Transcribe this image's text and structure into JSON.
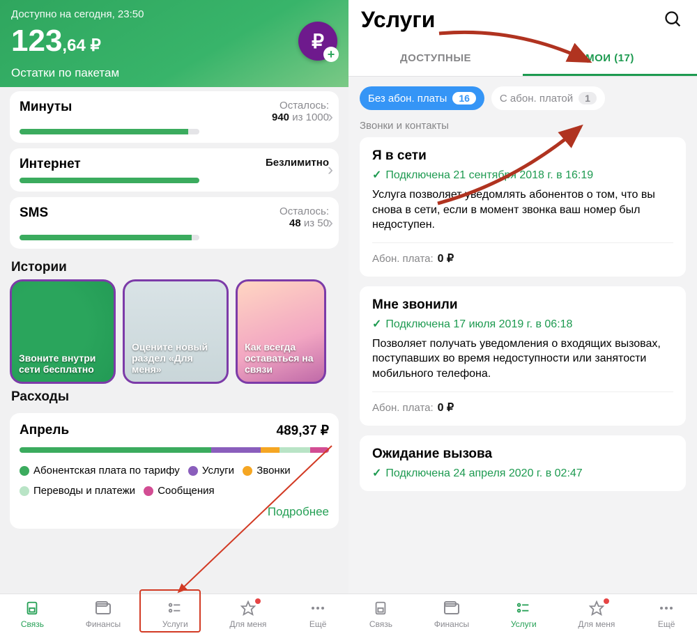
{
  "left": {
    "avail_label": "Доступно на сегодня, 23:50",
    "balance_int": "123",
    "balance_dec": ",64 ₽",
    "packs_header": "Остатки по пакетам",
    "packs": [
      {
        "name": "Минуты",
        "left_label": "Осталось:",
        "value": "940",
        "of": " из 1000",
        "pct": 94
      },
      {
        "name": "Интернет",
        "left_label": "",
        "value": "Безлимитно",
        "of": "",
        "pct": 100
      },
      {
        "name": "SMS",
        "left_label": "Осталось:",
        "value": "48",
        "of": " из 50",
        "pct": 96
      }
    ],
    "stories_header": "Истории",
    "stories": [
      "Звоните внутри сети бесплатно",
      "Оцените новый раздел «Для меня»",
      "Как всегда оставаться на связи"
    ],
    "expenses_header": "Расходы",
    "expenses": {
      "month": "Апрель",
      "total": "489,37 ₽",
      "segments": [
        {
          "color": "#3bab5e",
          "pct": 62
        },
        {
          "color": "#8a5ebc",
          "pct": 16
        },
        {
          "color": "#f5a623",
          "pct": 6
        },
        {
          "color": "#b9e4c6",
          "pct": 10
        },
        {
          "color": "#d24d93",
          "pct": 6
        }
      ],
      "legend": [
        {
          "color": "#3bab5e",
          "label": "Абонентская плата по тарифу"
        },
        {
          "color": "#8a5ebc",
          "label": "Услуги"
        },
        {
          "color": "#f5a623",
          "label": "Звонки"
        },
        {
          "color": "#b9e4c6",
          "label": "Переводы и платежи"
        },
        {
          "color": "#d24d93",
          "label": "Сообщения"
        }
      ],
      "more": "Подробнее"
    }
  },
  "right": {
    "title": "Услуги",
    "tabs": {
      "available": "ДОСТУПНЫЕ",
      "mine": "МОИ (17)"
    },
    "chips": {
      "no_fee": {
        "label": "Без абон. платы",
        "count": "16"
      },
      "with_fee": {
        "label": "С абон. платой",
        "count": "1"
      }
    },
    "group_label": "Звонки и контакты",
    "services": [
      {
        "name": "Я в сети",
        "connected": "Подключена 21 сентября 2018 г. в 16:19",
        "desc": "Услуга позволяет уведомлять абонентов о том, что вы снова в сети, если в момент звонка ваш номер был недоступен.",
        "fee_label": "Абон. плата:",
        "fee_value": "0 ₽"
      },
      {
        "name": "Мне звонили",
        "connected": "Подключена 17 июля 2019 г. в 06:18",
        "desc": "Позволяет получать уведомления о входящих вызовах, поступавших во время недоступности или занятости мобильного телефона.",
        "fee_label": "Абон. плата:",
        "fee_value": "0 ₽"
      },
      {
        "name": "Ожидание вызова",
        "connected": "Подключена 24 апреля 2020 г. в 02:47",
        "desc": "",
        "fee_label": "",
        "fee_value": ""
      }
    ]
  },
  "tabbar": [
    {
      "label": "Связь",
      "active_left": true,
      "active_right": false
    },
    {
      "label": "Финансы"
    },
    {
      "label": "Услуги",
      "active_right": true
    },
    {
      "label": "Для меня",
      "dot": true
    },
    {
      "label": "Ещё"
    }
  ]
}
